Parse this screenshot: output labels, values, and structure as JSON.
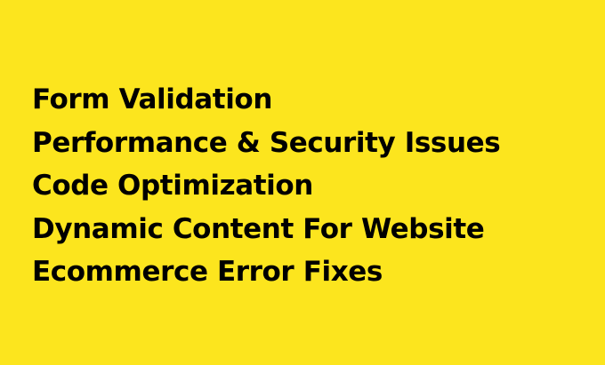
{
  "colors": {
    "background": "#fce51e",
    "text": "#000000"
  },
  "lines": [
    "Form Validation",
    "Performance & Security Issues",
    "Code Optimization",
    "Dynamic Content For Website",
    "Ecommerce Error Fixes"
  ]
}
